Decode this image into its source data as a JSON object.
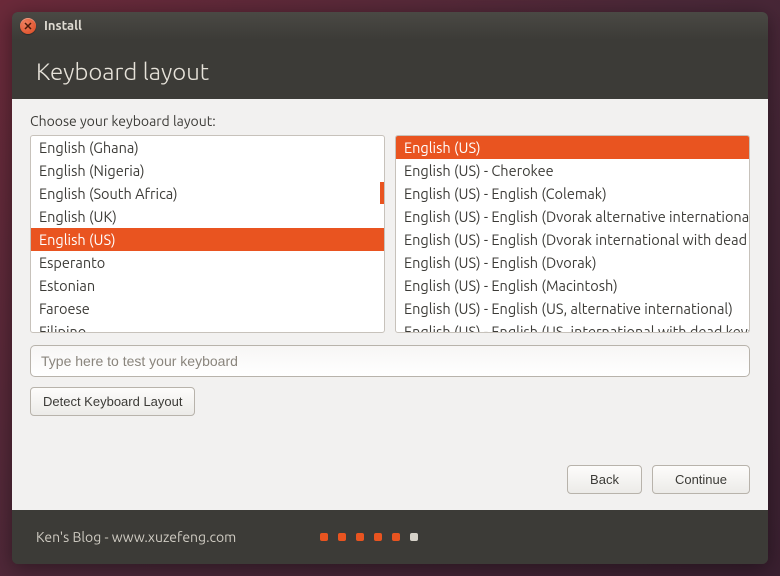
{
  "window": {
    "title": "Install"
  },
  "header": {
    "title": "Keyboard layout"
  },
  "prompt": "Choose your keyboard layout:",
  "layouts": {
    "items": [
      "English (Ghana)",
      "English (Nigeria)",
      "English (South Africa)",
      "English (UK)",
      "English (US)",
      "Esperanto",
      "Estonian",
      "Faroese",
      "Filipino"
    ],
    "selected_index": 4
  },
  "variants": {
    "items": [
      "English (US)",
      "English (US) - Cherokee",
      "English (US) - English (Colemak)",
      "English (US) - English (Dvorak alternative international no dead keys)",
      "English (US) - English (Dvorak international with dead keys)",
      "English (US) - English (Dvorak)",
      "English (US) - English (Macintosh)",
      "English (US) - English (US, alternative international)",
      "English (US) - English (US, international with dead keys)"
    ],
    "selected_index": 0
  },
  "test_input": {
    "placeholder": "Type here to test your keyboard",
    "value": ""
  },
  "buttons": {
    "detect": "Detect Keyboard Layout",
    "back": "Back",
    "continue": "Continue"
  },
  "footer": {
    "text": "Ken's Blog - www.xuzefeng.com",
    "progress": {
      "done": 5,
      "current": 1,
      "remaining": 0
    }
  },
  "colors": {
    "accent": "#e95420",
    "chrome": "#3c3b37",
    "panel": "#f2f1f0"
  }
}
